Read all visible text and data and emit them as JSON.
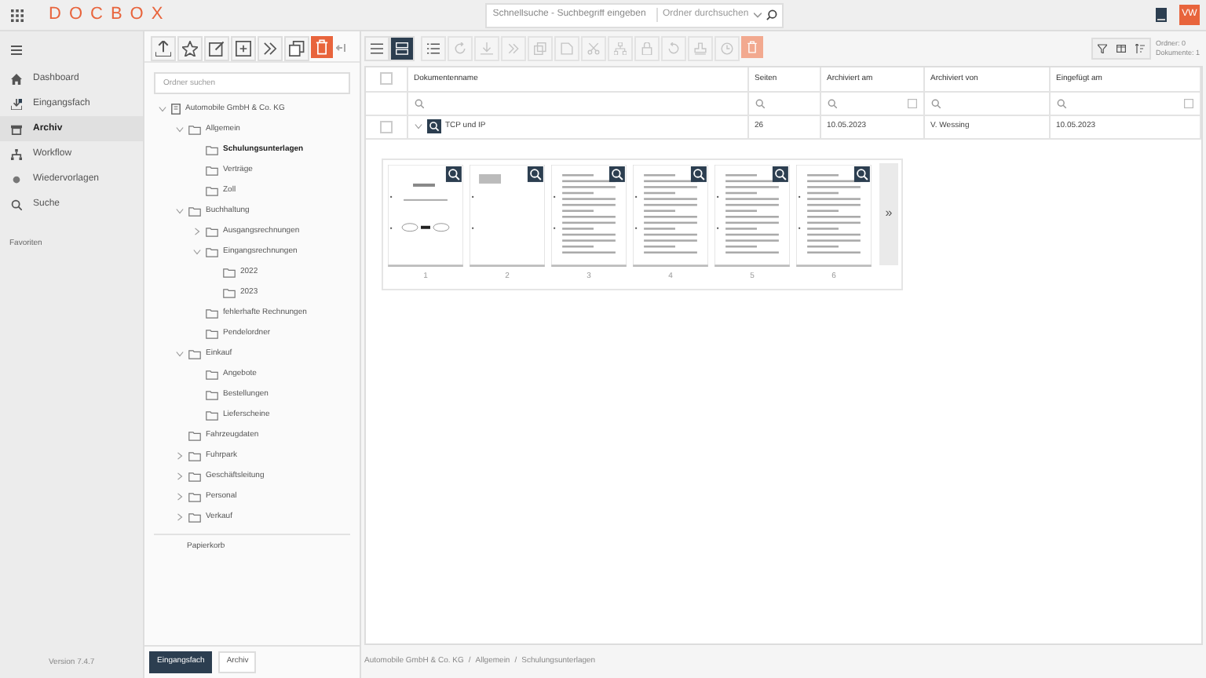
{
  "header": {
    "logo": "DOCBOX",
    "search": {
      "placeholder": "Schnellsuche - Suchbegriff eingeben",
      "scope": "Ordner durchsuchen"
    },
    "user_initials": "VW"
  },
  "nav": {
    "items": [
      {
        "label": "Dashboard",
        "selected": false
      },
      {
        "label": "Eingangsfach",
        "selected": false
      },
      {
        "label": "Archiv",
        "selected": true
      },
      {
        "label": "Workflow",
        "selected": false
      },
      {
        "label": "Wiedervorlagen",
        "selected": false
      },
      {
        "label": "Suche",
        "selected": false
      }
    ],
    "favorites_label": "Favoriten",
    "version": "Version 7.4.7"
  },
  "folders": {
    "search": {
      "placeholder": "Ordner suchen"
    },
    "tree": [
      {
        "label": "Automobile GmbH & Co. KG",
        "kind": "root",
        "expanded": true,
        "selected": false,
        "children": [
          {
            "label": "Allgemein",
            "expanded": true,
            "selected": false,
            "children": [
              {
                "label": "Schulungsunterlagen",
                "selected": true
              },
              {
                "label": "Verträge",
                "selected": false
              },
              {
                "label": "Zoll",
                "selected": false
              }
            ]
          },
          {
            "label": "Buchhaltung",
            "expanded": true,
            "selected": false,
            "children": [
              {
                "label": "Ausgangsrechnungen",
                "expanded": false,
                "selected": false
              },
              {
                "label": "Eingangsrechnungen",
                "expanded": true,
                "selected": false,
                "children": [
                  {
                    "label": "2022",
                    "selected": false
                  },
                  {
                    "label": "2023",
                    "selected": false
                  }
                ]
              },
              {
                "label": "fehlerhafte Rechnungen",
                "selected": false
              },
              {
                "label": "Pendelordner",
                "selected": false
              }
            ]
          },
          {
            "label": "Einkauf",
            "expanded": true,
            "selected": false,
            "children": [
              {
                "label": "Angebote",
                "selected": false
              },
              {
                "label": "Bestellungen",
                "selected": false
              },
              {
                "label": "Lieferscheine",
                "selected": false
              }
            ]
          },
          {
            "label": "Fahrzeugdaten",
            "selected": false
          },
          {
            "label": "Fuhrpark",
            "expanded": false,
            "selected": false
          },
          {
            "label": "Geschäftsleitung",
            "expanded": false,
            "selected": false
          },
          {
            "label": "Personal",
            "expanded": false,
            "selected": false
          },
          {
            "label": "Verkauf",
            "expanded": false,
            "selected": false
          }
        ]
      }
    ],
    "trash": "Papierkorb",
    "bottom_tabs": [
      {
        "label": "Eingangsfach",
        "selected": true
      },
      {
        "label": "Archiv",
        "selected": false
      }
    ]
  },
  "main": {
    "view_buttons": [
      {
        "selected": false
      },
      {
        "selected": true
      }
    ],
    "actions": [
      {
        "disabled": false
      },
      {
        "disabled": true
      },
      {
        "disabled": true
      },
      {
        "disabled": true
      },
      {
        "disabled": true
      },
      {
        "disabled": true
      },
      {
        "disabled": true
      },
      {
        "disabled": true
      },
      {
        "disabled": true
      },
      {
        "disabled": true
      },
      {
        "disabled": true
      },
      {
        "disabled": true
      }
    ],
    "counts": [
      "Ordner: 0",
      "Dokumente: 1"
    ],
    "select_all": {
      "checked": false
    },
    "table": {
      "columns": [
        "Dokumentenname",
        "Seiten",
        "Archiviert am",
        "Archiviert von",
        "Eingefügt am"
      ],
      "rows": [
        {
          "checked": false,
          "expanded": true,
          "cells": [
            "TCP und IP",
            "26",
            "10.05.2023",
            "V. Wessing",
            "10.05.2023"
          ]
        }
      ]
    },
    "pages": [
      "1",
      "2",
      "3",
      "4",
      "5",
      "6"
    ],
    "more": "»",
    "breadcrumb": [
      "Automobile GmbH & Co. KG",
      "Allgemein",
      "Schulungsunterlagen"
    ],
    "breadcrumb_separators": [
      "/",
      "/"
    ]
  }
}
